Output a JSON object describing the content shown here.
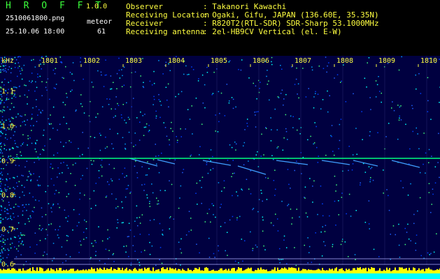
{
  "header": {
    "app_title": "H R O F F T",
    "app_version": "1.0.0",
    "file_name": "2510061800.png",
    "datetime": "25.10.06 18:00",
    "meteor_label": "meteor",
    "meteor_count": "61",
    "info": [
      {
        "label": "Observer",
        "value": ": Takanori Kawachi"
      },
      {
        "label": "Receiving Location",
        "value": ": Ogaki, Gifu, JAPAN (136.60E, 35.35N)"
      },
      {
        "label": "Receiver",
        "value": ": R820T2(RTL-SDR) SDR-Sharp 53.1000MHz"
      },
      {
        "label": "Receiving antenna",
        "value": ": 2el-HB9CV Vertical (el. E-W)"
      }
    ]
  },
  "spectrogram": {
    "y_unit": "kHz",
    "y_ticks": [
      "1.1",
      "1.0",
      "0.9",
      "0.8",
      "0.7",
      "0.6"
    ],
    "x_ticks": [
      "1801",
      "1802",
      "1803",
      "1804",
      "1805",
      "1806",
      "1807",
      "1808",
      "1809",
      "1810"
    ],
    "colors": {
      "background": "#000040",
      "grid": "#2a2a70",
      "signal": "#00ff80",
      "axis_text": "#ffff40",
      "bottom_band": "#ffff00",
      "cyan_band": "#00ffff"
    }
  }
}
